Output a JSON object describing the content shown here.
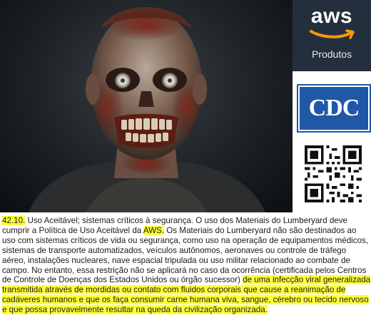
{
  "sidebar": {
    "aws_logo": "aws",
    "aws_label": "Produtos",
    "cdc_logo": "CDC"
  },
  "clause": {
    "lines": [
      [
        {
          "t": "42.10.",
          "hl": true
        },
        {
          "t": " Uso Aceitável; sistemas críticos à segurança. O uso dos Materiais do Lumberyard deve",
          "hl": false
        }
      ],
      [
        {
          "t": "cumprir a Política de Uso Aceitável da ",
          "hl": false
        },
        {
          "t": "AWS.",
          "hl": true
        },
        {
          "t": " Os Materiais do Lumberyard não são destinados ao",
          "hl": false
        }
      ],
      [
        {
          "t": "uso com sistemas críticos de vida ou segurança, como uso na operação de equipamentos médicos,",
          "hl": false
        }
      ],
      [
        {
          "t": "sistemas de transporte automatizados, veículos autônomos, aeronaves ou controle de tráfego",
          "hl": false
        }
      ],
      [
        {
          "t": "aéreo, instalações nucleares, nave espacial tripulada ou uso militar relacionado ao combate de",
          "hl": false
        }
      ],
      [
        {
          "t": "campo. No entanto, essa restrição não se aplicará no caso da ocorrência (certificada pelos Centros",
          "hl": false
        }
      ],
      [
        {
          "t": "de Controle de Doenças dos Estados Unidos ou órgão sucessor) ",
          "hl": false
        },
        {
          "t": "de uma infecção viral generalizada",
          "hl": true
        }
      ],
      [
        {
          "t": "transmitida através de mordidas ou contato com fluidos corporais que cause a reanimação de",
          "hl": true
        }
      ],
      [
        {
          "t": "cadáveres humanos e que os faça consumir carne humana viva, sangue, cérebro ou tecido nervoso",
          "hl": true
        }
      ],
      [
        {
          "t": "e que possa provavelmente resultar na queda da civilização organizada.",
          "hl": true
        }
      ]
    ]
  },
  "colors": {
    "highlight": "#ffff3a",
    "aws_bg": "#242f3e",
    "aws_smile": "#ff9900",
    "cdc_blue": "#1e58a6"
  }
}
